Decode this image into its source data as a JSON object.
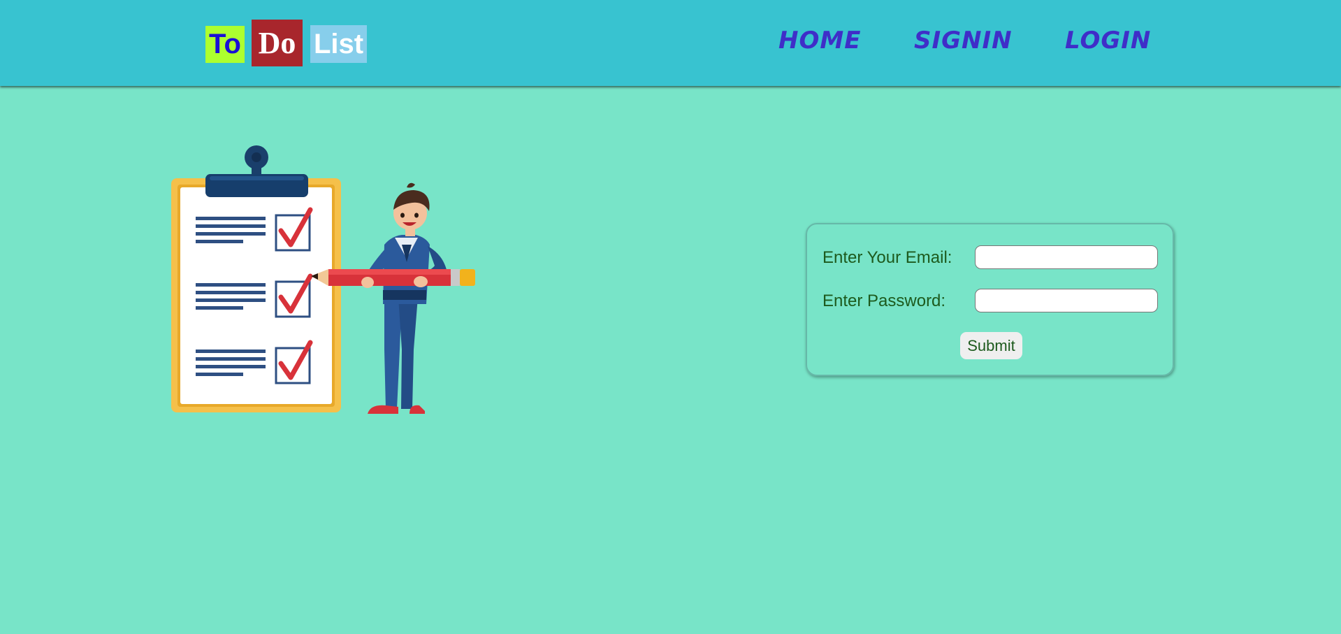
{
  "header": {
    "logo": {
      "part1": "To",
      "part2": "Do",
      "part3": "List"
    },
    "nav": {
      "home": "HOME",
      "signin": "SIGNIN",
      "login": "LOGIN"
    }
  },
  "illustration": {
    "icon": "person-with-checklist-clipboard-illustration"
  },
  "form": {
    "email_label": "Enter Your Email:",
    "email_value": "",
    "email_placeholder": "",
    "password_label": "Enter Password:",
    "password_value": "",
    "password_placeholder": "",
    "submit_label": "Submit"
  },
  "colors": {
    "page_background": "#78e4c8",
    "header_background": "#38c3d0",
    "nav_text": "#3f2ec8",
    "logo_to_bg": "#adff2f",
    "logo_do_bg": "#a8262c",
    "logo_list_bg": "#87ceeb",
    "form_text": "#1d5a1d"
  }
}
